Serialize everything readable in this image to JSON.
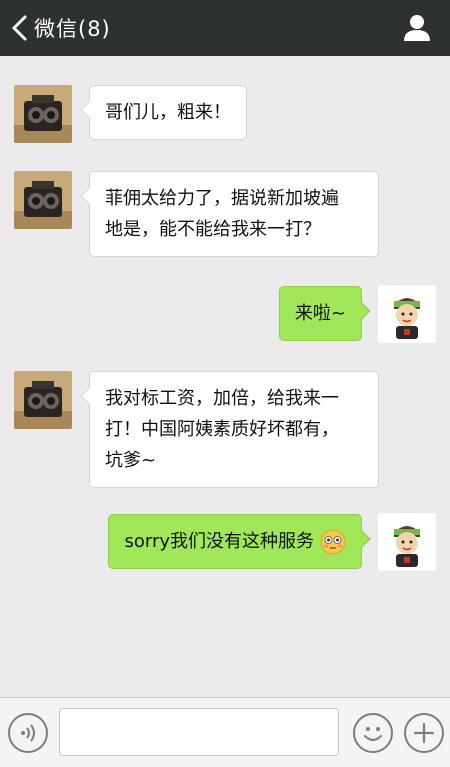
{
  "header": {
    "back_label": "微信(8)",
    "back_icon": "chevron-left-icon",
    "profile_icon": "person-icon",
    "background": "#2e3132"
  },
  "messages": [
    {
      "side": "left",
      "text": "哥们儿，粗来！",
      "avatar": "camera-avatar"
    },
    {
      "side": "left",
      "text_lines": [
        "菲佣太给力了，据说新加坡遍",
        "地是，能不能给我来一打？"
      ],
      "avatar": "camera-avatar"
    },
    {
      "side": "right",
      "text": "来啦~",
      "avatar": "cartoon-avatar"
    },
    {
      "side": "left",
      "text_lines": [
        "我对标工资，加倍，给我来一",
        "打！中国阿姨素质好坏都有，",
        "坑爹~"
      ],
      "avatar": "camera-avatar"
    },
    {
      "side": "right",
      "text": "sorry我们没有这种服务",
      "emoji": "flushed-face-emoji",
      "avatar": "cartoon-avatar"
    }
  ],
  "input_bar": {
    "voice_icon": "voice-icon",
    "emoji_icon": "smiley-icon",
    "plus_icon": "plus-icon",
    "input_value": ""
  },
  "colors": {
    "chat_background": "#ebebeb",
    "bubble_left": "#ffffff",
    "bubble_right": "#a0e75a"
  }
}
